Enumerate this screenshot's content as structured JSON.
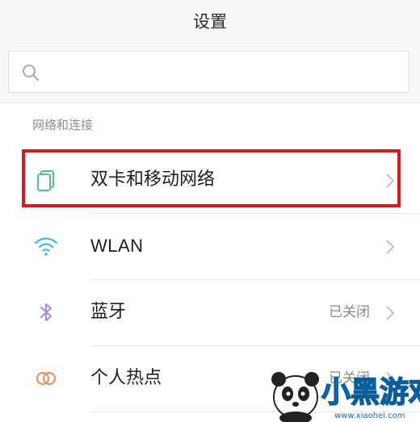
{
  "header": {
    "title": "设置"
  },
  "search": {
    "placeholder": "",
    "icon": "search-icon"
  },
  "section": {
    "title": "网络和连接"
  },
  "rows": [
    {
      "label": "双卡和移动网络",
      "status": "",
      "icon": "dual-sim-icon"
    },
    {
      "label": "WLAN",
      "status": "",
      "icon": "wifi-icon"
    },
    {
      "label": "蓝牙",
      "status": "已关闭",
      "icon": "bluetooth-icon"
    },
    {
      "label": "个人热点",
      "status": "已关闭",
      "icon": "hotspot-icon"
    }
  ],
  "watermark": {
    "brand": "小黑游戏",
    "url": "www.xiaohei.com"
  },
  "colors": {
    "highlight": "#e0161e",
    "sim_icon": "#4dbf9a",
    "wifi_icon": "#3fb8e8",
    "bluetooth_icon": "#a88be6",
    "hotspot_icon": "#ef8a5c"
  }
}
